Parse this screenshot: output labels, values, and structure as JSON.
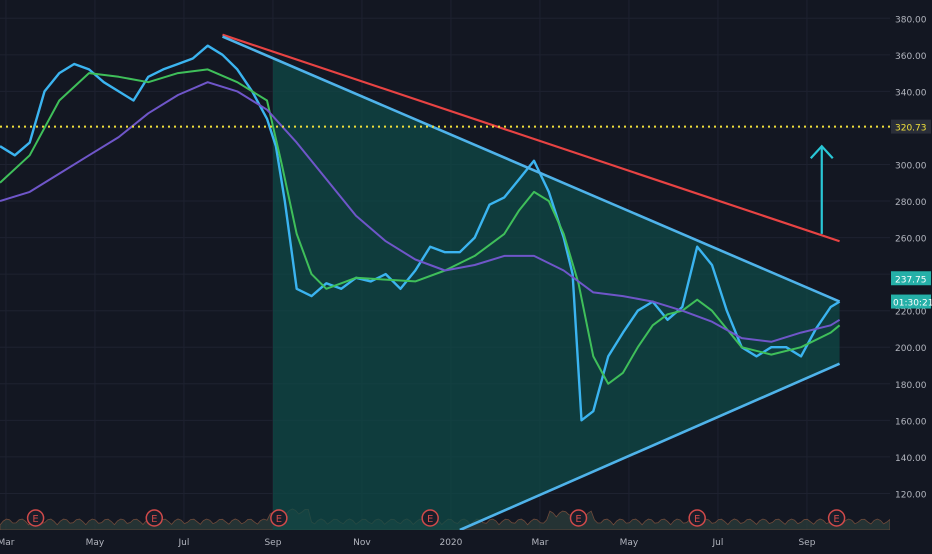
{
  "colors": {
    "background": "#131722",
    "grid": "#1e2230",
    "price": "#3bb4f0",
    "ma_short": "#3fbf5a",
    "ma_long": "#6f56c9",
    "resistance": "#e84343",
    "triangle": "#4fb3ea",
    "triangle_fill": "#0f4a47",
    "dotted_level": "#f0e03a",
    "arrow": "#29c7d6",
    "label_text": "#b2b5be",
    "badge_bg": "#25b0a8",
    "earnings": "#d14a4a"
  },
  "chart_data": {
    "type": "line",
    "title": "",
    "xlabel": "",
    "ylabel": "",
    "ylim": [
      100,
      390
    ],
    "x_range": [
      0,
      30
    ],
    "x_ticks": [
      {
        "x": 0.2,
        "label": "Mar"
      },
      {
        "x": 3.2,
        "label": "May"
      },
      {
        "x": 6.2,
        "label": "Jul"
      },
      {
        "x": 9.2,
        "label": "Sep"
      },
      {
        "x": 12.2,
        "label": "Nov"
      },
      {
        "x": 15.2,
        "label": "2020"
      },
      {
        "x": 18.2,
        "label": "Mar"
      },
      {
        "x": 21.2,
        "label": "May"
      },
      {
        "x": 24.2,
        "label": "Jul"
      },
      {
        "x": 27.2,
        "label": "Sep"
      }
    ],
    "y_ticks": [
      "120.00",
      "140.00",
      "160.00",
      "180.00",
      "200.00",
      "220.00",
      "240.00",
      "260.00",
      "280.00",
      "300.00",
      "320.00",
      "340.00",
      "360.00",
      "380.00"
    ],
    "current_price": {
      "label": "237.75",
      "value": 237.75
    },
    "countdown": {
      "label": "01:30:21",
      "value": 225
    },
    "level_label": {
      "label": "320.73",
      "value": 320.73
    },
    "series": [
      {
        "key": "price",
        "x": [
          0,
          0.5,
          1,
          1.5,
          2,
          2.5,
          3,
          3.5,
          4,
          4.5,
          5,
          5.5,
          6,
          6.5,
          7,
          7.5,
          8,
          8.5,
          9,
          9.3,
          9.6,
          10,
          10.5,
          11,
          11.5,
          12,
          12.5,
          13,
          13.5,
          14,
          14.5,
          15,
          15.5,
          16,
          16.5,
          17,
          17.5,
          18,
          18.5,
          19,
          19.3,
          19.6,
          20,
          20.5,
          21,
          21.5,
          22,
          22.5,
          23,
          23.5,
          24,
          24.5,
          25,
          25.5,
          26,
          26.5,
          27,
          27.5,
          28,
          28.3
        ],
        "values": [
          310,
          305,
          312,
          340,
          350,
          355,
          352,
          345,
          340,
          335,
          348,
          352,
          355,
          358,
          365,
          360,
          352,
          340,
          325,
          310,
          280,
          232,
          228,
          235,
          232,
          238,
          236,
          240,
          232,
          242,
          255,
          252,
          252,
          260,
          278,
          282,
          292,
          302,
          285,
          260,
          240,
          160,
          165,
          195,
          208,
          220,
          225,
          215,
          222,
          255,
          245,
          220,
          200,
          195,
          200,
          200,
          195,
          210,
          222,
          225
        ],
        "style": "solid"
      },
      {
        "key": "ma_short",
        "x": [
          0,
          1,
          2,
          3,
          4,
          5,
          6,
          7,
          8,
          9,
          9.5,
          10,
          10.5,
          11,
          11.5,
          12,
          13,
          14,
          15,
          16,
          17,
          17.5,
          18,
          18.5,
          19,
          19.5,
          20,
          20.5,
          21,
          21.5,
          22,
          22.5,
          23,
          23.5,
          24,
          25,
          26,
          27,
          28,
          28.3
        ],
        "values": [
          290,
          305,
          335,
          350,
          348,
          345,
          350,
          352,
          345,
          335,
          300,
          262,
          240,
          232,
          235,
          238,
          237,
          236,
          242,
          250,
          262,
          275,
          285,
          280,
          262,
          235,
          195,
          180,
          186,
          200,
          212,
          218,
          220,
          226,
          220,
          200,
          196,
          200,
          208,
          212
        ],
        "style": "solid"
      },
      {
        "key": "ma_long",
        "x": [
          0,
          1,
          2,
          3,
          4,
          5,
          6,
          7,
          8,
          9,
          10,
          11,
          12,
          13,
          14,
          15,
          16,
          17,
          18,
          19,
          20,
          21,
          22,
          23,
          24,
          25,
          26,
          27,
          28,
          28.3
        ],
        "values": [
          280,
          285,
          295,
          305,
          315,
          328,
          338,
          345,
          340,
          330,
          312,
          292,
          272,
          258,
          248,
          242,
          245,
          250,
          250,
          242,
          230,
          228,
          225,
          220,
          214,
          205,
          203,
          208,
          212,
          215
        ],
        "style": "solid"
      }
    ],
    "overlays": {
      "resistance_line": {
        "x": [
          7.5,
          28.3
        ],
        "values": [
          371,
          258
        ]
      },
      "triangle_upper": {
        "x": [
          7.5,
          28.3
        ],
        "values": [
          370,
          225
        ]
      },
      "triangle_lower": {
        "x": [
          15.5,
          28.3
        ],
        "values": [
          100,
          191
        ]
      },
      "dotted_level": {
        "value": 320.73
      },
      "arrow": {
        "x": [
          27.7,
          27.7
        ],
        "values": [
          262,
          310
        ]
      },
      "shaded_start_x": 9.2,
      "earnings_markers": {
        "x": [
          1.2,
          5.2,
          9.4,
          14.5,
          19.5,
          23.5,
          28.2
        ],
        "label": "E"
      }
    }
  }
}
